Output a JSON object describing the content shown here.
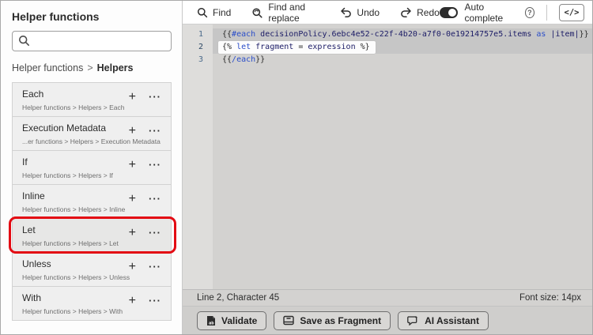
{
  "sidebar": {
    "title": "Helper functions",
    "search": {
      "placeholder": ""
    },
    "breadcrumb": {
      "parent": "Helper functions",
      "separator": ">",
      "current": "Helpers"
    },
    "add_label": "+",
    "more_label": "···",
    "items": [
      {
        "title": "Each",
        "path": "Helper functions > Helpers > Each"
      },
      {
        "title": "Execution Metadata",
        "path": "...er functions > Helpers > Execution Metadata"
      },
      {
        "title": "If",
        "path": "Helper functions > Helpers > If"
      },
      {
        "title": "Inline",
        "path": "Helper functions > Helpers > Inline"
      },
      {
        "title": "Let",
        "path": "Helper functions > Helpers > Let",
        "highlighted": true
      },
      {
        "title": "Unless",
        "path": "Helper functions > Helpers > Unless"
      },
      {
        "title": "With",
        "path": "Helper functions > Helpers > With"
      }
    ]
  },
  "toolbar": {
    "find": "Find",
    "find_replace": "Find and replace",
    "undo": "Undo",
    "redo": "Redo",
    "autocomplete_label": "Auto complete",
    "autocomplete_on": true,
    "help_glyph": "?",
    "code_toggle": "</>"
  },
  "editor": {
    "syntax_colors": {
      "keyword": "#2b4ec9",
      "identifier": "#1c1c66",
      "punctuation": "#2b2b2b"
    },
    "lines": [
      {
        "number": "1",
        "tokens": [
          {
            "text": "{{",
            "type": "punct"
          },
          {
            "text": "#each",
            "type": "keyword"
          },
          {
            "text": " decisionPolicy.6ebc4e52-c22f-4b20-a7f0-0e19214757e5.items ",
            "type": "identifier"
          },
          {
            "text": "as",
            "type": "keyword"
          },
          {
            "text": " |item|",
            "type": "identifier"
          },
          {
            "text": "}}",
            "type": "punct"
          }
        ]
      },
      {
        "number": "2",
        "tokens": [
          {
            "text": "{% ",
            "type": "punct"
          },
          {
            "text": "let",
            "type": "keyword"
          },
          {
            "text": " fragment ",
            "type": "identifier"
          },
          {
            "text": "= ",
            "type": "punct"
          },
          {
            "text": "expression ",
            "type": "identifier"
          },
          {
            "text": "%}",
            "type": "punct"
          }
        ]
      },
      {
        "number": "3",
        "tokens": [
          {
            "text": "{{",
            "type": "punct"
          },
          {
            "text": "/each",
            "type": "keyword"
          },
          {
            "text": "}}",
            "type": "punct"
          }
        ]
      }
    ]
  },
  "statusbar": {
    "position": "Line 2, Character 45",
    "font_size": "Font size: 14px"
  },
  "actions": [
    {
      "label": "Validate"
    },
    {
      "label": "Save as Fragment"
    },
    {
      "label": "AI Assistant"
    }
  ],
  "annotation": {
    "color": "#e30b13",
    "target": "Let helper card"
  }
}
